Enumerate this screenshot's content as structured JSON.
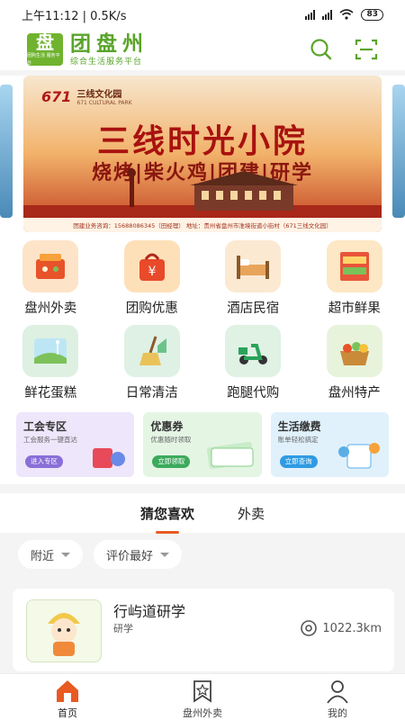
{
  "status_bar": {
    "time": "上午11:12 | 0.5K/s",
    "battery": "83"
  },
  "header": {
    "logo_char": "盘",
    "logo_small": "团购生活 服务平台",
    "app_name": "团盘州",
    "app_subtitle": "综合生活服务平台"
  },
  "banner": {
    "brand_num": "671",
    "brand_name": "三线文化园",
    "brand_sub": "671 CULTURAL PARK",
    "title": "三线时光小院",
    "subtitle": "烧烤|柴火鸡|团建|研学",
    "footer": "团建业务咨询：15688086345（田经理） 地址：贵州省盘州市淮境街道小街村（671三线文化园）"
  },
  "categories": [
    {
      "label": "盘州外卖",
      "color": "#fde4c8"
    },
    {
      "label": "团购优惠",
      "color": "#fde0b8"
    },
    {
      "label": "酒店民宿",
      "color": "#fbe9d2"
    },
    {
      "label": "超市鲜果",
      "color": "#fde7c4"
    },
    {
      "label": "鲜花蛋糕",
      "color": "#ddf0e2"
    },
    {
      "label": "日常清洁",
      "color": "#dff1e5"
    },
    {
      "label": "跑腿代购",
      "color": "#dff2e4"
    },
    {
      "label": "盘州特产",
      "color": "#e8f3dc"
    }
  ],
  "cards": [
    {
      "title": "工会专区",
      "subtitle": "工会服务一键直达",
      "button": "进入专区",
      "bg": "#eee6fb",
      "btn_color": "#8a6fd8"
    },
    {
      "title": "优惠券",
      "subtitle": "优惠随时领取",
      "button": "立即领取",
      "bg": "#e4f5e4",
      "btn_color": "#3daa5c"
    },
    {
      "title": "生活缴费",
      "subtitle": "账单轻松搞定",
      "button": "立即查询",
      "bg": "#e0f1fb",
      "btn_color": "#2f9be3"
    }
  ],
  "tabs": [
    {
      "label": "猜您喜欢"
    },
    {
      "label": "外卖"
    }
  ],
  "filters": [
    {
      "label": "附近"
    },
    {
      "label": "评价最好"
    }
  ],
  "listing": {
    "title": "行屿道研学",
    "tag": "研学",
    "distance": "1022.3km"
  },
  "bottom_nav": [
    {
      "label": "首页"
    },
    {
      "label": "盘州外卖"
    },
    {
      "label": "我的"
    }
  ],
  "colors": {
    "brand_green": "#5aa42a",
    "accent_orange": "#e85a22"
  }
}
